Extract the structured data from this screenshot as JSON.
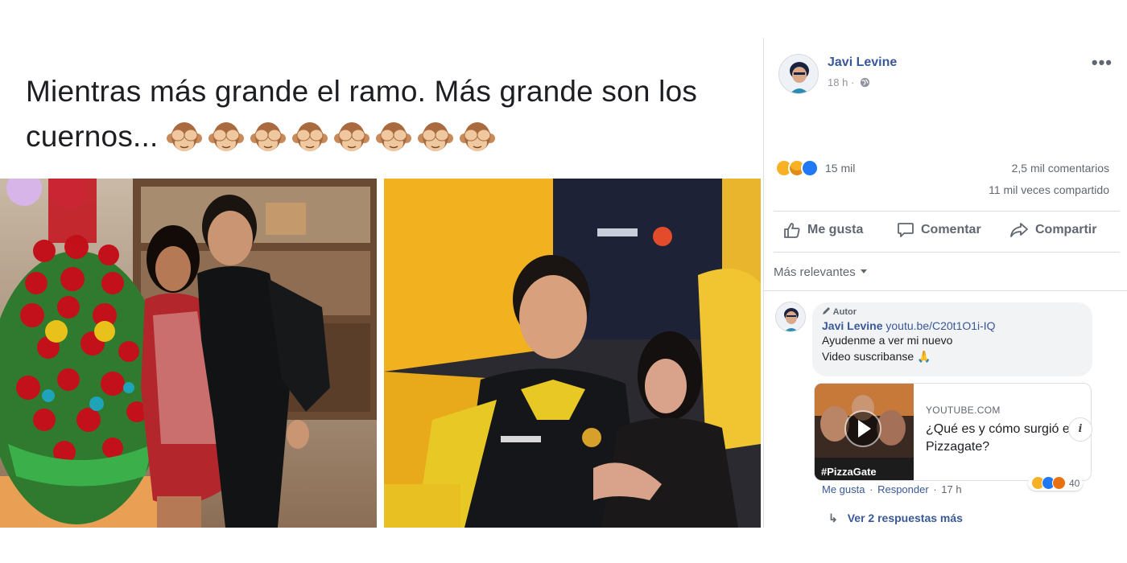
{
  "post": {
    "text": "Mientras más grande el ramo. Más grande son los cuernos...",
    "emoji_icon": "see-no-evil-monkey-emoji",
    "emoji_count": 8
  },
  "panel": {
    "author": "Javi Levine",
    "time": "18 h",
    "privacy_icon": "globe-icon",
    "more_label": "•••",
    "reactions_count": "15 mil",
    "comments_count": "2,5 mil comentarios",
    "shares_count": "11 mil veces compartido",
    "actions": {
      "like": "Me gusta",
      "comment": "Comentar",
      "share": "Compartir"
    },
    "sort_label": "Más relevantes"
  },
  "comment": {
    "badge": "Autor",
    "author": "Javi Levine",
    "link": "youtu.be/C20t1O1i-IQ",
    "line1": "Ayudenme a ver mi nuevo",
    "line2": "Video suscribanse 🙏",
    "card": {
      "domain": "YOUTUBE.COM",
      "title": "¿Qué es y cómo surgió el Pizzagate?",
      "thumb_caption": "#PizzaGate"
    },
    "info_label": "i",
    "actions": {
      "like": "Me gusta",
      "reply": "Responder",
      "time": "17 h"
    },
    "reaction_count": "40",
    "more_replies": "Ver 2 respuestas más"
  },
  "colors": {
    "link_blue": "#385898",
    "secondary": "#606770",
    "text": "#1c1e21",
    "divider": "#dadde1"
  }
}
